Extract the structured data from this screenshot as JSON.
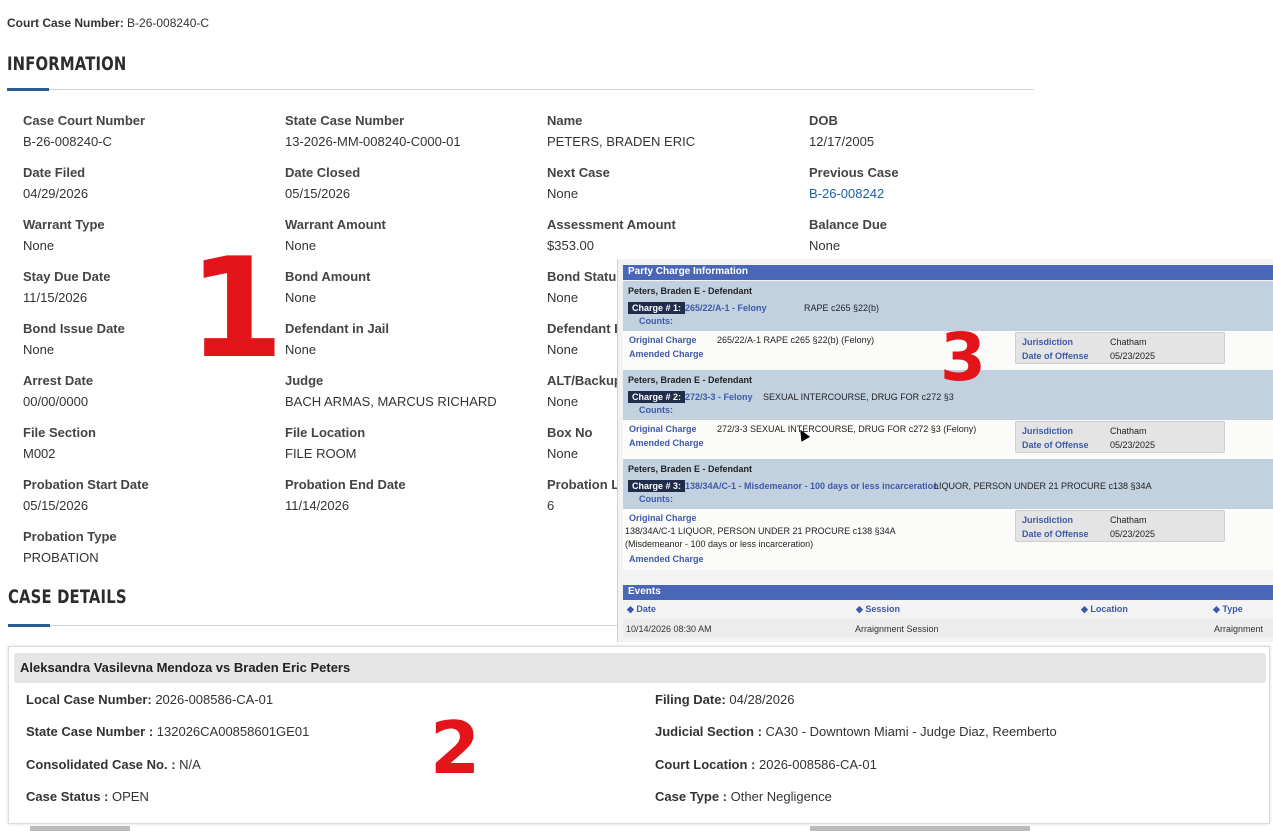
{
  "header": {
    "court_case_label": "Court Case Number:",
    "court_case_value": "B-26-008240-C"
  },
  "information": {
    "title": "INFORMATION",
    "fields": {
      "case_court_number": {
        "label": "Case Court Number",
        "value": "B-26-008240-C"
      },
      "state_case_number": {
        "label": "State Case Number",
        "value": "13-2026-MM-008240-C000-01"
      },
      "name": {
        "label": "Name",
        "value": "PETERS, BRADEN ERIC"
      },
      "dob": {
        "label": "DOB",
        "value": "12/17/2005"
      },
      "date_filed": {
        "label": "Date Filed",
        "value": "04/29/2026"
      },
      "date_closed": {
        "label": "Date Closed",
        "value": "05/15/2026"
      },
      "next_case": {
        "label": "Next Case",
        "value": "None"
      },
      "previous_case": {
        "label": "Previous Case",
        "value": "B-26-008242"
      },
      "warrant_type": {
        "label": "Warrant Type",
        "value": "None"
      },
      "warrant_amount": {
        "label": "Warrant Amount",
        "value": "None"
      },
      "assessment_amount": {
        "label": "Assessment Amount",
        "value": "$353.00"
      },
      "balance_due": {
        "label": "Balance Due",
        "value": "None"
      },
      "stay_due_date": {
        "label": "Stay Due Date",
        "value": "11/15/2026"
      },
      "bond_amount": {
        "label": "Bond Amount",
        "value": "None"
      },
      "bond_status": {
        "label": "Bond Status",
        "value": "None"
      },
      "bond_issue_date": {
        "label": "Bond Issue Date",
        "value": "None"
      },
      "defendant_in_jail": {
        "label": "Defendant in Jail",
        "value": "None"
      },
      "defendant_partial": {
        "label": "Defendant I",
        "value": "None"
      },
      "arrest_date": {
        "label": "Arrest Date",
        "value": "00/00/0000"
      },
      "judge": {
        "label": "Judge",
        "value": "BACH ARMAS, MARCUS RICHARD"
      },
      "alt_backup": {
        "label": "ALT/Backup",
        "value": "None"
      },
      "file_section": {
        "label": "File Section",
        "value": "M002"
      },
      "file_location": {
        "label": "File Location",
        "value": "FILE ROOM"
      },
      "box_no": {
        "label": "Box No",
        "value": "None"
      },
      "probation_start_date": {
        "label": "Probation Start Date",
        "value": "05/15/2026"
      },
      "probation_end_date": {
        "label": "Probation End Date",
        "value": "11/14/2026"
      },
      "probation_l": {
        "label": "Probation L",
        "value": "6"
      },
      "probation_type": {
        "label": "Probation Type",
        "value": "PROBATION"
      }
    }
  },
  "case_details": {
    "title": "CASE DETAILS",
    "panel_title": "Aleksandra Vasilevna Mendoza vs Braden Eric Peters",
    "local_case_number": {
      "label": "Local Case Number:",
      "value": "2026-008586-CA-01"
    },
    "state_case_number": {
      "label": "State Case Number :",
      "value": "132026CA00858601GE01"
    },
    "consolidated_case": {
      "label": "Consolidated Case No. :",
      "value": "N/A"
    },
    "case_status": {
      "label": "Case Status :",
      "value": "OPEN"
    },
    "filing_date": {
      "label": "Filing Date:",
      "value": "04/28/2026"
    },
    "judicial_section": {
      "label": "Judicial Section :",
      "value": "CA30 - Downtown Miami - Judge Diaz, Reemberto"
    },
    "court_location": {
      "label": "Court Location :",
      "value": "2026-008586-CA-01"
    },
    "case_type": {
      "label": "Case Type :",
      "value": "Other Negligence"
    }
  },
  "party_charge": {
    "title": "Party Charge Information",
    "charges": [
      {
        "party": "Peters, Braden E - Defendant",
        "tag": "Charge # 1:",
        "code": "265/22/A-1 - Felony",
        "description": "RAPE c265 §22(b)",
        "counts_label": "Counts:",
        "original_label": "Original Charge",
        "original_text": "265/22/A-1 RAPE c265 §22(b) (Felony)",
        "amended_label": "Amended Charge",
        "jurisdiction_label": "Jurisdiction",
        "jurisdiction_value": "Chatham",
        "offense_label": "Date of Offense",
        "offense_value": "05/23/2025"
      },
      {
        "party": "Peters, Braden E - Defendant",
        "tag": "Charge # 2:",
        "code": "272/3-3 - Felony",
        "description": "SEXUAL INTERCOURSE, DRUG FOR c272 §3",
        "counts_label": "Counts:",
        "original_label": "Original Charge",
        "original_text": "272/3-3 SEXUAL INTERCOURSE, DRUG FOR c272 §3 (Felony)",
        "amended_label": "Amended Charge",
        "jurisdiction_label": "Jurisdiction",
        "jurisdiction_value": "Chatham",
        "offense_label": "Date of Offense",
        "offense_value": "05/23/2025"
      },
      {
        "party": "Peters, Braden E - Defendant",
        "tag": "Charge # 3:",
        "code": "138/34A/C-1 - Misdemeanor - 100 days or less incarceration",
        "description": "LIQUOR, PERSON UNDER 21 PROCURE c138 §34A",
        "counts_label": "Counts:",
        "original_label": "Original Charge",
        "original_text_1": "138/34A/C-1 LIQUOR, PERSON UNDER 21 PROCURE c138 §34A",
        "original_text_2": "(Misdemeanor - 100 days or less incarceration)",
        "amended_label": "Amended Charge",
        "jurisdiction_label": "Jurisdiction",
        "jurisdiction_value": "Chatham",
        "offense_label": "Date of Offense",
        "offense_value": "05/23/2025"
      }
    ]
  },
  "events": {
    "title": "Events",
    "columns": [
      "◆ Date",
      "◆ Session",
      "◆ Location",
      "◆ Type"
    ],
    "rows": [
      {
        "date": "10/14/2026 08:30 AM",
        "session": "Arraignment Session",
        "location": "",
        "type": "Arraignment"
      }
    ]
  },
  "annotations": {
    "one": "1",
    "two": "2",
    "three": "3"
  },
  "colors": {
    "accent": "#2a5f8f",
    "link": "#1d5fa8",
    "panel_header": "#4a67b7",
    "annotation_red": "#e4141b"
  }
}
